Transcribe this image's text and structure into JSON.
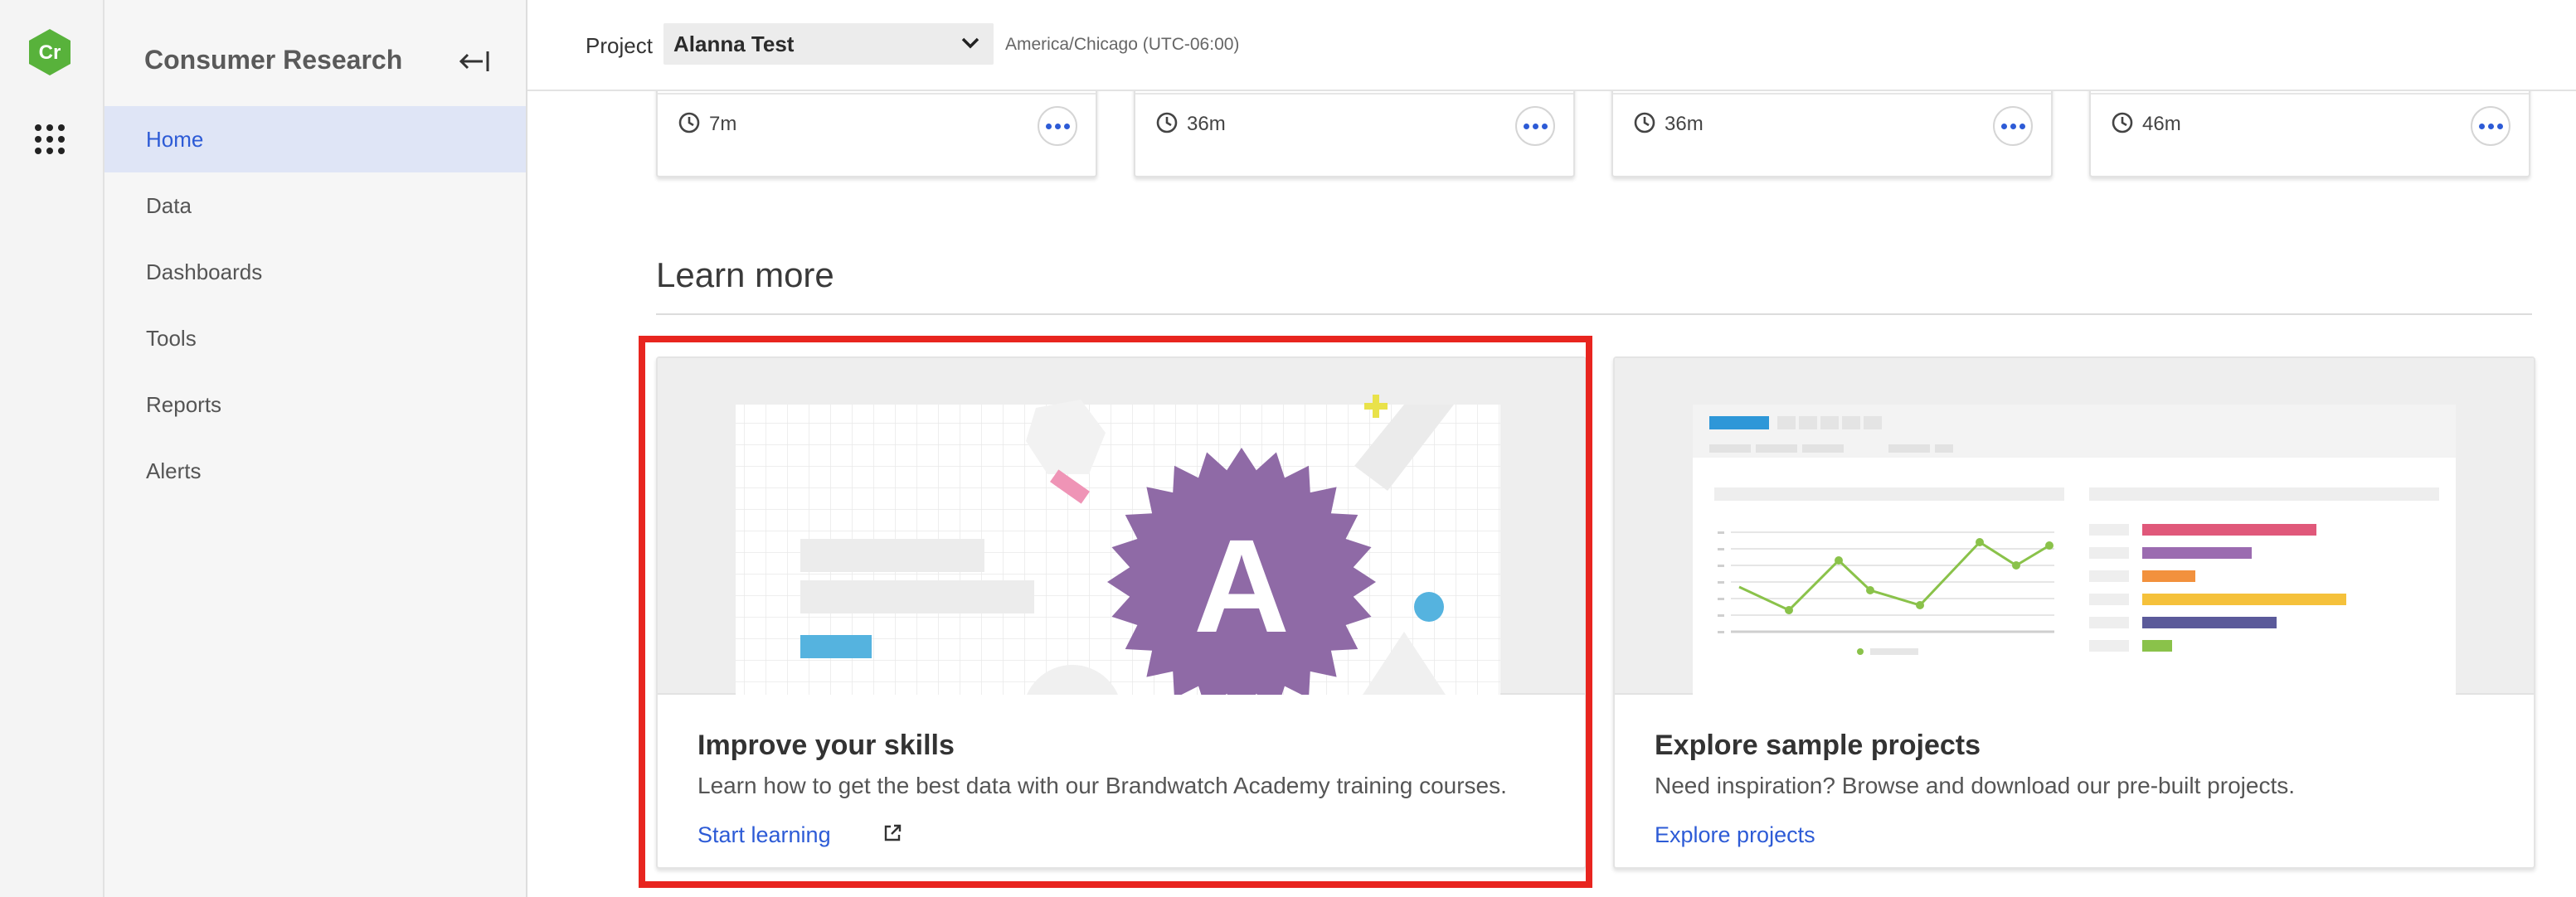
{
  "app": {
    "logo_text": "Cr",
    "name": "Consumer Research",
    "brand_color": "#58b23b",
    "accent_color": "#2d5bd6"
  },
  "rail": {
    "apps_icon": "grid-icon"
  },
  "sidebar": {
    "title": "Consumer Research",
    "collapse_icon": "collapse-left-icon",
    "items": [
      {
        "label": "Home",
        "active": true
      },
      {
        "label": "Data",
        "active": false
      },
      {
        "label": "Dashboards",
        "active": false
      },
      {
        "label": "Tools",
        "active": false
      },
      {
        "label": "Reports",
        "active": false
      },
      {
        "label": "Alerts",
        "active": false
      }
    ]
  },
  "topbar": {
    "project_label": "Project",
    "project_value": "Alanna Test",
    "timezone": "America/Chicago (UTC-06:00)"
  },
  "recent_cards": [
    {
      "duration": "7m"
    },
    {
      "duration": "36m"
    },
    {
      "duration": "36m"
    },
    {
      "duration": "46m"
    }
  ],
  "learn_more": {
    "title": "Learn more",
    "cards": [
      {
        "title": "Improve your skills",
        "description": "Learn how to get the best data with our Brandwatch Academy training courses.",
        "link": "Start learning",
        "badge_letter": "A",
        "highlighted": true,
        "highlight_color": "#e8251f"
      },
      {
        "title": "Explore sample projects",
        "description": "Need inspiration? Browse and download our pre-built projects.",
        "link": "Explore projects",
        "highlighted": false
      }
    ]
  }
}
